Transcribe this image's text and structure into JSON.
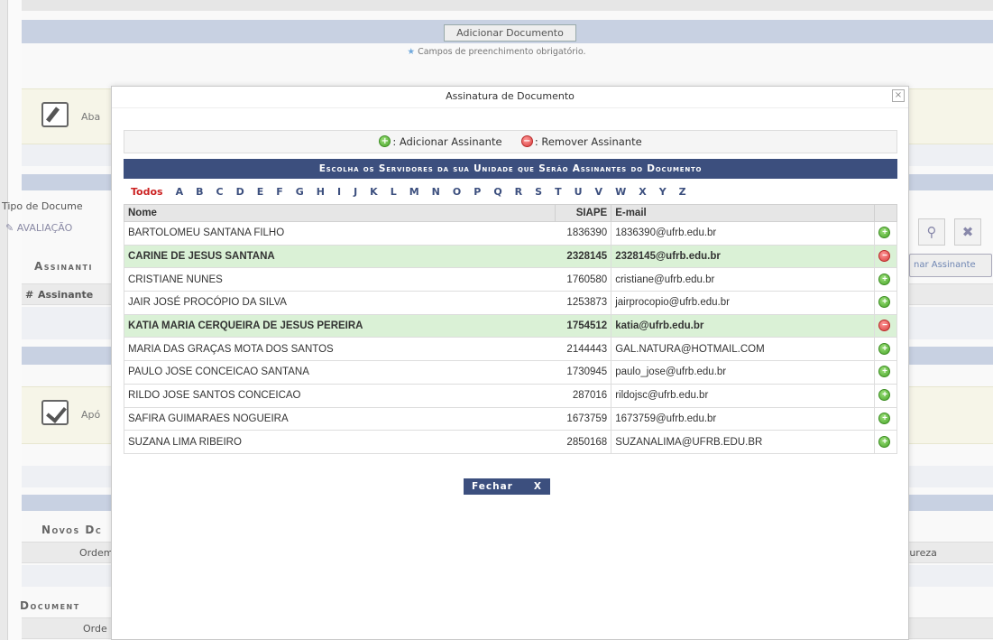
{
  "background": {
    "add_document_button": "Adicionar Documento",
    "required_note": "Campos de preenchimento obrigatório.",
    "tip1_text": "Aba",
    "tip2_text": "Apó",
    "tipo_documento_label": "Tipo de Docume",
    "tipo_documento_value": "AVALIAÇÃO",
    "assinantes_title": "Assinanti",
    "grid_col_hash": "#",
    "grid_col_assinante": "Assinante",
    "adicionar_assinante_btn": "nar Assinante",
    "novos_docs_title": "Novos Dc",
    "novos_docs_col_ordem": "Ordem",
    "novos_docs_col_natureza": "tureza",
    "documentos_title": "Document",
    "documentos_col_ordem": "Orde"
  },
  "modal": {
    "title": "Assinatura de Documento",
    "close_glyph": "×",
    "legend_add": ": Adicionar Assinante",
    "legend_remove": ": Remover Assinante",
    "selection_header": "Escolha os Servidores da sua Unidade que Serão Assinantes do Documento",
    "alphabet": [
      "Todos",
      "A",
      "B",
      "C",
      "D",
      "E",
      "F",
      "G",
      "H",
      "I",
      "J",
      "K",
      "L",
      "M",
      "N",
      "O",
      "P",
      "Q",
      "R",
      "S",
      "T",
      "U",
      "V",
      "W",
      "X",
      "Y",
      "Z"
    ],
    "columns": {
      "name": "Nome",
      "siape": "SIAPE",
      "email": "E-mail"
    },
    "rows": [
      {
        "name": "BARTOLOMEU SANTANA FILHO",
        "siape": "1836390",
        "email": "1836390@ufrb.edu.br",
        "selected": false
      },
      {
        "name": "CARINE DE JESUS SANTANA",
        "siape": "2328145",
        "email": "2328145@ufrb.edu.br",
        "selected": true
      },
      {
        "name": "CRISTIANE NUNES",
        "siape": "1760580",
        "email": "cristiane@ufrb.edu.br",
        "selected": false
      },
      {
        "name": "JAIR JOSÉ PROCÓPIO DA SILVA",
        "siape": "1253873",
        "email": "jairprocopio@ufrb.edu.br",
        "selected": false
      },
      {
        "name": "KATIA MARIA CERQUEIRA DE JESUS PEREIRA",
        "siape": "1754512",
        "email": "katia@ufrb.edu.br",
        "selected": true
      },
      {
        "name": "MARIA DAS GRAÇAS MOTA DOS SANTOS",
        "siape": "2144443",
        "email": "GAL.NATURA@HOTMAIL.COM",
        "selected": false
      },
      {
        "name": "PAULO JOSE CONCEICAO SANTANA",
        "siape": "1730945",
        "email": "paulo_jose@ufrb.edu.br",
        "selected": false
      },
      {
        "name": "RILDO JOSE SANTOS CONCEICAO",
        "siape": "287016",
        "email": "rildojsc@ufrb.edu.br",
        "selected": false
      },
      {
        "name": "SAFIRA GUIMARAES NOGUEIRA",
        "siape": "1673759",
        "email": "1673759@ufrb.edu.br",
        "selected": false
      },
      {
        "name": "SUZANA LIMA RIBEIRO",
        "siape": "2850168",
        "email": "SUZANALIMA@UFRB.EDU.BR",
        "selected": false
      }
    ],
    "fechar_label": "Fechar",
    "fechar_x": "X"
  },
  "colors": {
    "header_blue": "#3c4f7e",
    "selected_row": "#daf1d6",
    "add_green": "#4aa52a",
    "remove_red": "#d83c3c",
    "todos_red": "#cc2222"
  },
  "icons": {
    "add_row": "plus-circle-green-icon",
    "remove_row": "minus-circle-red-icon"
  }
}
